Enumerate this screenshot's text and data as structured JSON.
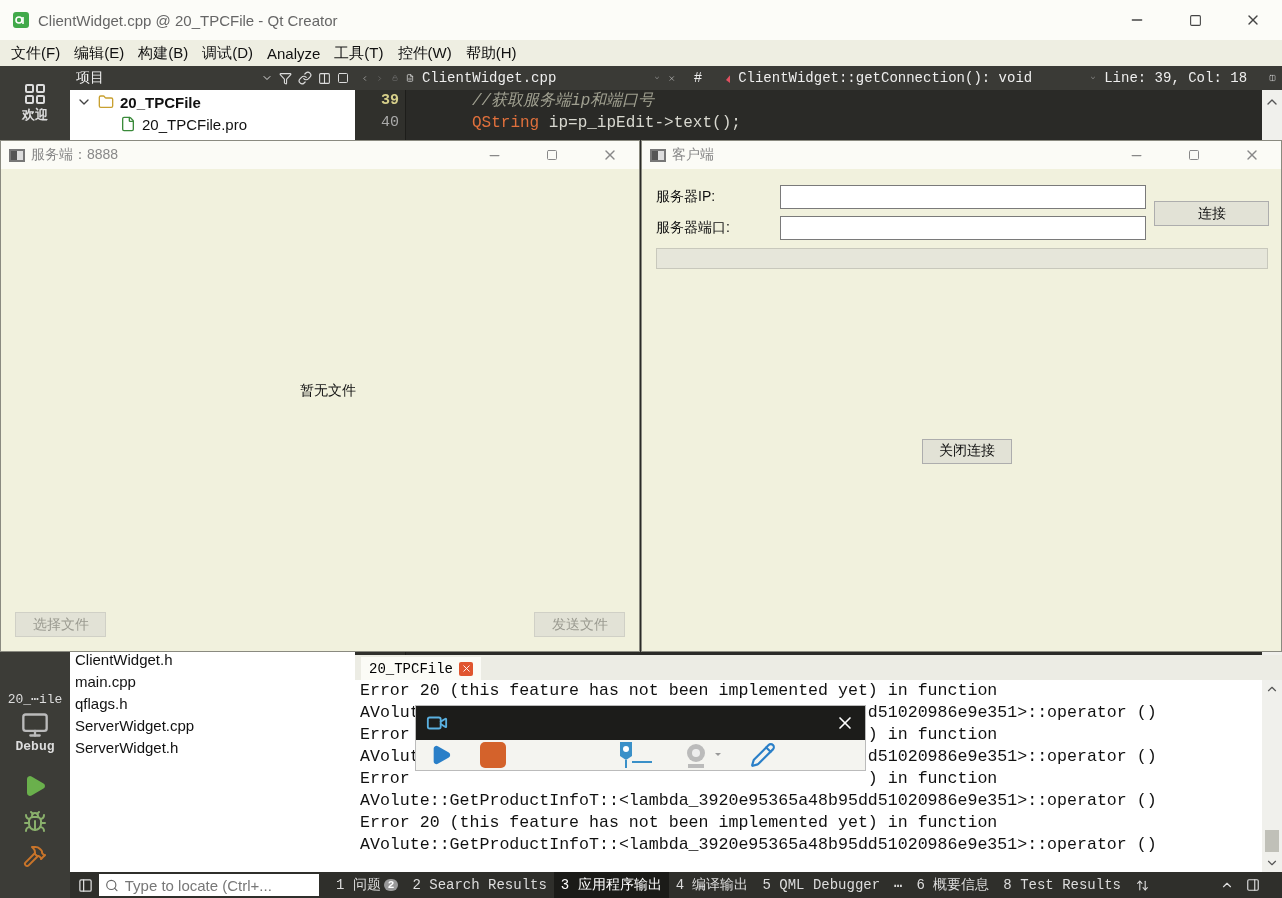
{
  "window": {
    "title": "ClientWidget.cpp @ 20_TPCFile - Qt Creator"
  },
  "menu": [
    "文件(F)",
    "编辑(E)",
    "构建(B)",
    "调试(D)",
    "Analyze",
    "工具(T)",
    "控件(W)",
    "帮助(H)"
  ],
  "mode_bar": {
    "welcome": "欢迎",
    "kit": "20_⋯ile",
    "build_config": "Debug"
  },
  "project_pane": {
    "title": "项目",
    "tree": [
      {
        "name": "20_TPCFile",
        "expanded": true,
        "children": [
          {
            "name": "20_TPCFile.pro"
          }
        ]
      }
    ],
    "files": [
      "ClientWidget.h",
      "main.cpp",
      "qflags.h",
      "ServerWidget.cpp",
      "ServerWidget.h"
    ]
  },
  "editor": {
    "file": "ClientWidget.cpp",
    "hash": "#",
    "symbol": "ClientWidget::getConnection(): void",
    "position": "Line: 39, Col: 18",
    "lines": [
      {
        "number": "39",
        "current": true,
        "tokens": [
          {
            "kind": "comment",
            "text": "//获取服务端ip和端口号"
          }
        ]
      },
      {
        "number": "40",
        "current": false,
        "tokens": [
          {
            "kind": "type",
            "text": "QString"
          },
          {
            "kind": "plain",
            "text": " ip=p_ipEdit->text();"
          }
        ]
      }
    ]
  },
  "server_window": {
    "title": "服务端：8888",
    "empty_text": "暂无文件",
    "buttons": [
      {
        "label": "选择文件",
        "disabled": true
      },
      {
        "label": "发送文件",
        "disabled": true
      }
    ]
  },
  "client_window": {
    "title": "客户端",
    "fields": [
      {
        "label": "服务器IP:"
      },
      {
        "label": "服务器端口:"
      }
    ],
    "connect_button": "连接",
    "progress": {
      "level": 0
    },
    "close_button": "关闭连接"
  },
  "output": {
    "tab": "20_TPCFile",
    "lines": [
      {
        "text": "Error 20 (this feature has not been implemented yet) in function"
      },
      {
        "start": "AVolut",
        "end": "d51020986e9e351>::operator ()"
      },
      {
        "start": "Error",
        "end": ") in function"
      },
      {
        "start": "AVolut",
        "end": "d51020986e9e351>::operator ()"
      },
      {
        "start": "Error",
        "end": ") in function"
      },
      {
        "text": "AVolute::GetProductInfoT::<lambda_3920e95365a48b95dd51020986e9e351>::operator ()"
      },
      {
        "text": "Error 20 (this feature has not been implemented yet) in function"
      },
      {
        "text": "AVolute::GetProductInfoT::<lambda_3920e95365a48b95dd51020986e9e351>::operator ()"
      }
    ]
  },
  "status_bar": {
    "search_placeholder": "Type to locate (Ctrl+...",
    "tabs": [
      {
        "label": "1 问题",
        "badge": "2",
        "selected": false
      },
      {
        "label": "2 Search Results",
        "selected": false
      },
      {
        "label": "3 应用程序输出",
        "selected": true
      },
      {
        "label": "4 编译输出",
        "selected": false
      },
      {
        "label": "5 QML Debugger",
        "selected": false
      },
      {
        "label": "⋯",
        "selected": false
      },
      {
        "label": "6 概要信息",
        "selected": false
      },
      {
        "label": "8 Test Results",
        "selected": false
      }
    ]
  }
}
